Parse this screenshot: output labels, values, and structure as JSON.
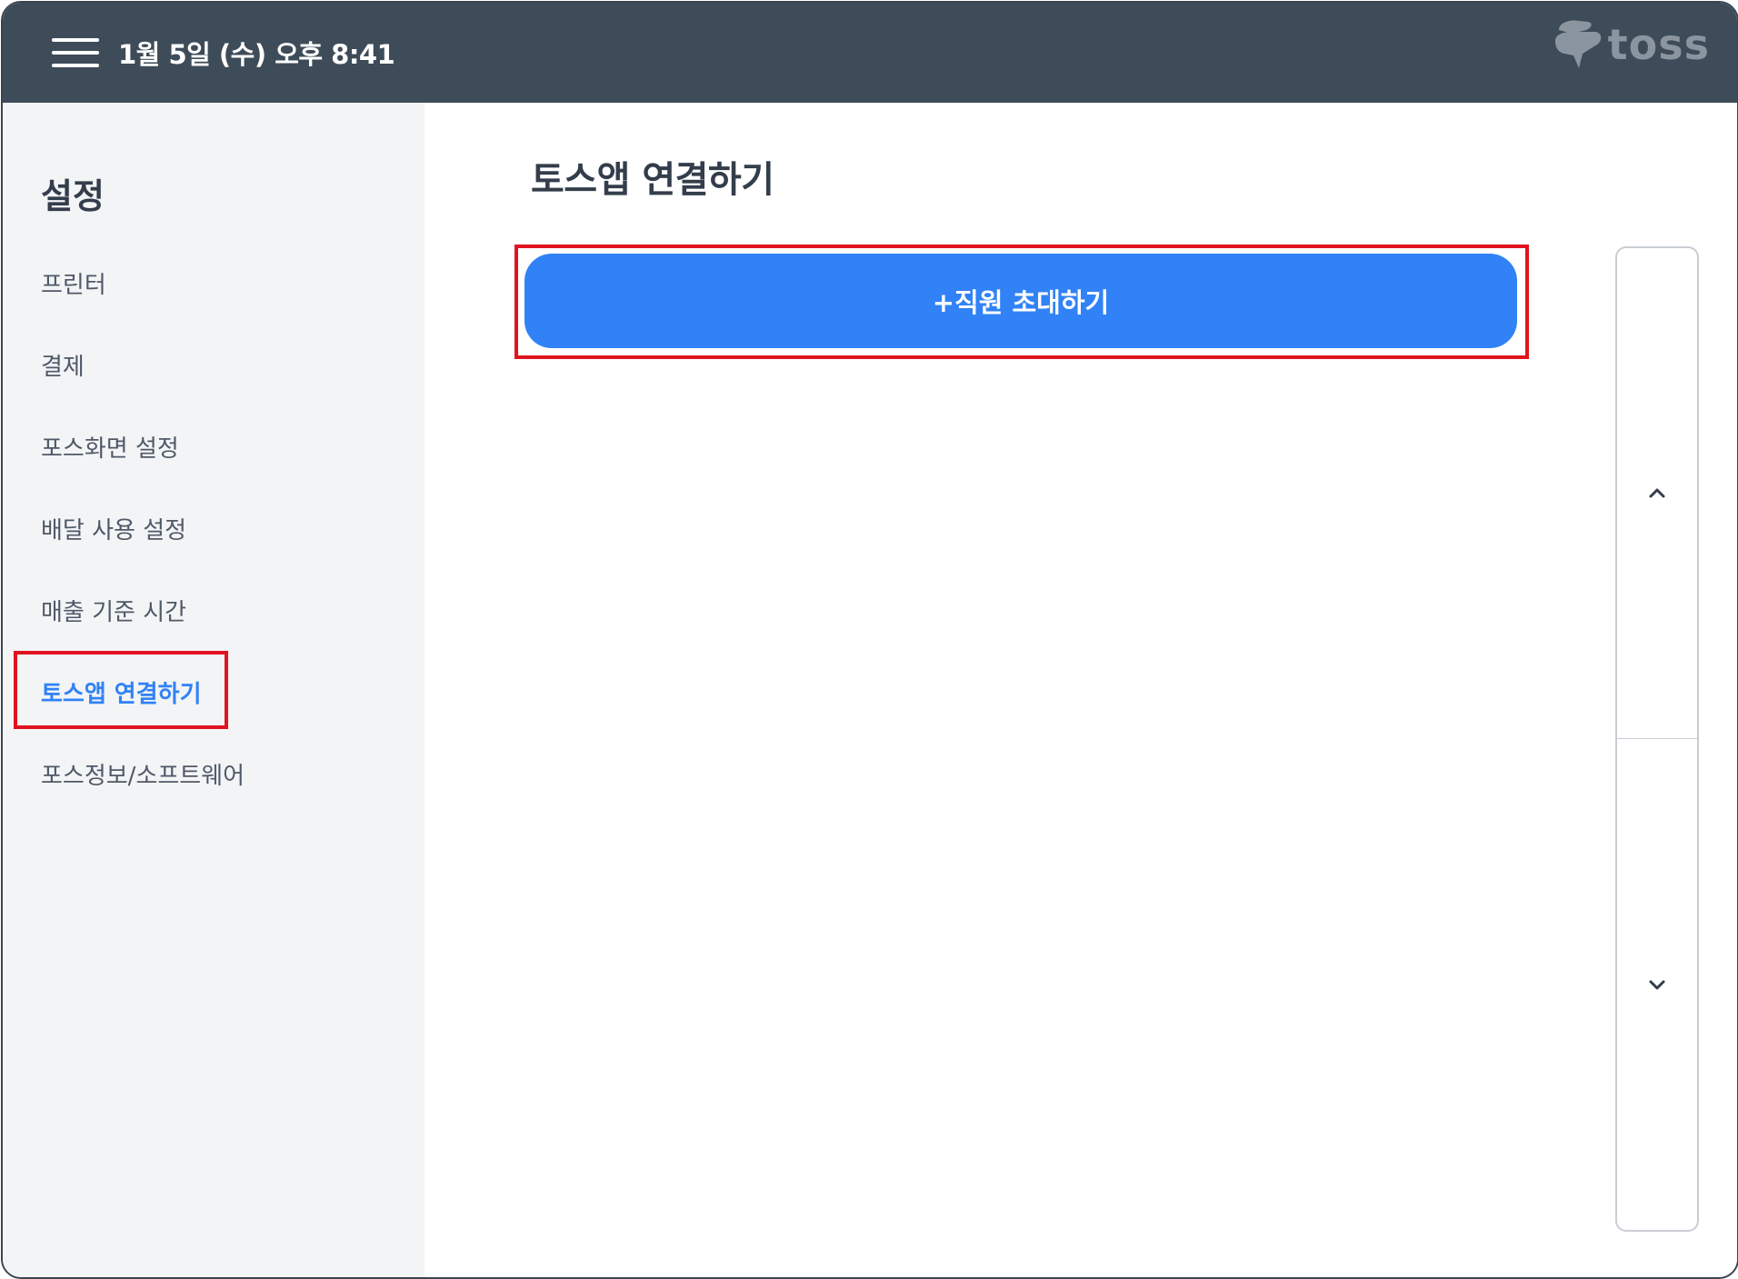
{
  "header": {
    "menu_icon": "hamburger-menu-icon",
    "datetime": "1월 5일 (수) 오후 8:41",
    "logo_text": "toss"
  },
  "sidebar": {
    "title": "설정",
    "items": [
      {
        "label": "프린터",
        "active": false
      },
      {
        "label": "결제",
        "active": false
      },
      {
        "label": "포스화면 설정",
        "active": false
      },
      {
        "label": "배달 사용 설정",
        "active": false
      },
      {
        "label": "매출 기준 시간",
        "active": false
      },
      {
        "label": "토스앱 연결하기",
        "active": true
      },
      {
        "label": "포스정보/소프트웨어",
        "active": false
      }
    ]
  },
  "main": {
    "title": "토스앱 연결하기",
    "invite_button_label": "+직원 초대하기"
  },
  "scroll": {
    "up_icon": "chevron-up-icon",
    "down_icon": "chevron-down-icon"
  },
  "colors": {
    "topbar": "#3e4b58",
    "accent": "#3182f6",
    "highlight": "#e0141e",
    "sidebar_bg": "#f3f4f6"
  }
}
